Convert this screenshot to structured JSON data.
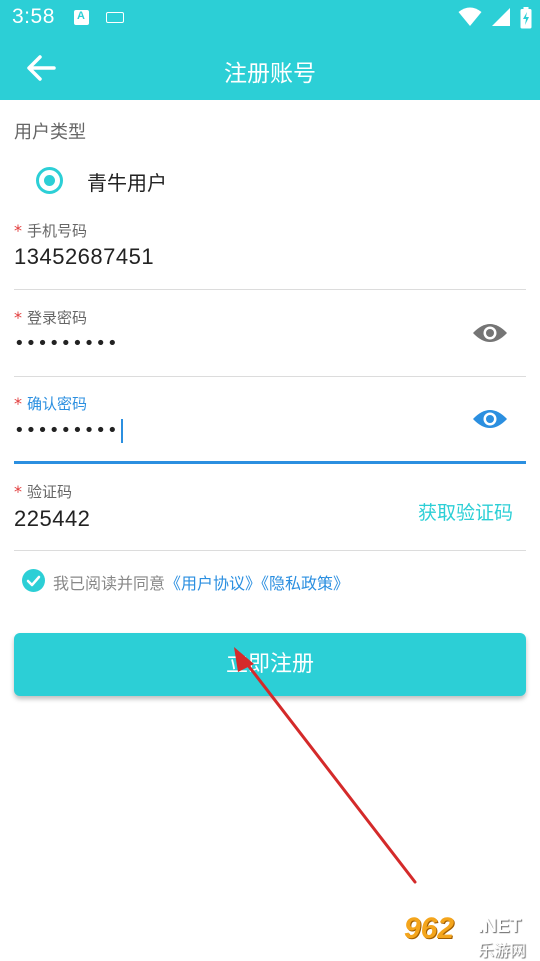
{
  "status_bar": {
    "time": "3:58",
    "notification_icon_letter": "A",
    "icons": [
      "notification-a-icon",
      "keyboard-icon",
      "wifi-icon",
      "cell-signal-icon",
      "battery-charging-icon"
    ]
  },
  "app_bar": {
    "title": "注册账号",
    "back_icon": "back-arrow-icon"
  },
  "form": {
    "user_type_label": "用户类型",
    "user_type_option": "青牛用户",
    "required_mark": "*",
    "phone": {
      "label": "手机号码",
      "value": "13452687451"
    },
    "password": {
      "label": "登录密码",
      "value": "•••••••••",
      "icon": "eye-icon"
    },
    "confirm_password": {
      "label": "确认密码",
      "value": "•••••••••",
      "icon": "eye-icon"
    },
    "code": {
      "label": "验证码",
      "value": "225442",
      "get_code_label": "获取验证码"
    },
    "agreement": {
      "prefix": "我已阅读并同意",
      "user_agreement": "《用户协议》",
      "privacy_policy": "《隐私政策》"
    },
    "submit_label": "立即注册"
  },
  "colors": {
    "primary": "#2ccfd6",
    "focus_blue": "#2b8fe0",
    "required_red": "#e23b3b",
    "annotation_arrow": "#d42a2a"
  },
  "watermark": {
    "number": "962",
    "suffix": ".NET",
    "name": "乐游网"
  }
}
